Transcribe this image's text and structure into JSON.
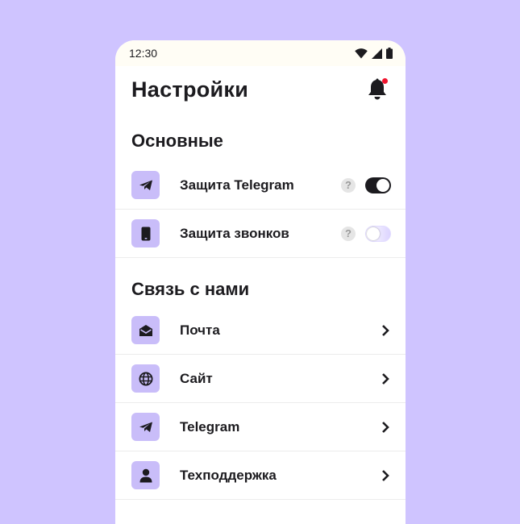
{
  "status_bar": {
    "time": "12:30",
    "icons": [
      "wifi-icon",
      "signal-icon",
      "battery-icon"
    ]
  },
  "header": {
    "title": "Настройки",
    "bell_icon": "bell-icon",
    "notification_dot_color": "#F0142E"
  },
  "sections": {
    "main": {
      "title": "Основные",
      "items": [
        {
          "label": "Защита Telegram",
          "icon": "telegram-icon",
          "help": "?",
          "toggle": true
        },
        {
          "label": "Защита звонков",
          "icon": "phone-icon",
          "help": "?",
          "toggle": false
        }
      ]
    },
    "contact": {
      "title": "Связь с нами",
      "items": [
        {
          "label": "Почта",
          "icon": "mail-icon"
        },
        {
          "label": "Сайт",
          "icon": "globe-icon"
        },
        {
          "label": "Telegram",
          "icon": "telegram-icon"
        },
        {
          "label": "Техподдержка",
          "icon": "user-icon"
        }
      ]
    }
  },
  "colors": {
    "background": "#CFC4FF",
    "icon_bg": "#C9BDF9",
    "toggle_on": "#1c1b1f"
  }
}
